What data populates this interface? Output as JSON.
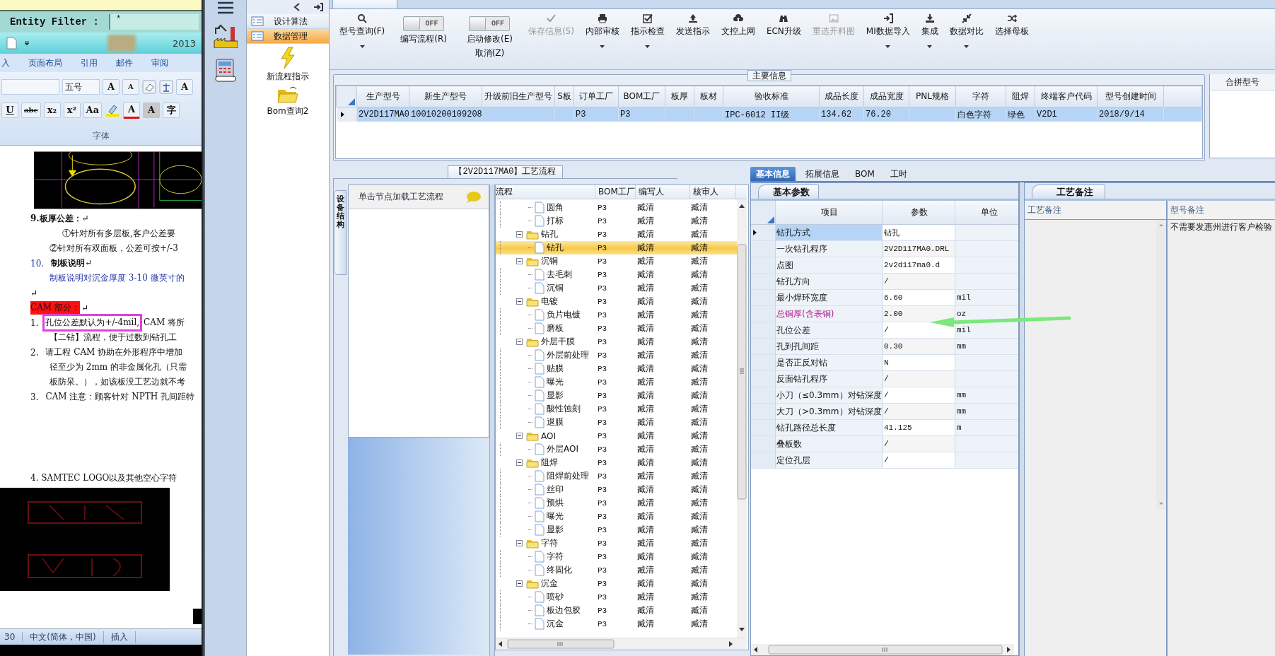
{
  "entity_filter": {
    "label": "Entity Filter :",
    "value": "*"
  },
  "word_window": {
    "title_fragment": "2013",
    "ribbon_tabs": [
      "入",
      "页面布局",
      "引用",
      "邮件",
      "审阅"
    ],
    "font_size": "五号",
    "row1_buttons": [
      "A",
      "A",
      "A"
    ],
    "row2_buttons": [
      "U",
      "abc",
      "x₂",
      "x²",
      "Aa",
      "A",
      "A",
      "字"
    ],
    "group_label": "字体",
    "document": [
      {
        "kind": "picture"
      },
      {
        "kind": "para",
        "text": "**9.板厚公差：**↵"
      },
      {
        "kind": "deep",
        "text": "①针对所有多层板,客户公差要"
      },
      {
        "kind": "sub",
        "text": "②针对所有双面板，公差可按+/-3"
      },
      {
        "kind": "numbered_heading",
        "number": "10.",
        "text": "**制板说明**↵"
      },
      {
        "kind": "note",
        "text": "制板说明对沉金厚度 3-10 微英寸的"
      },
      {
        "kind": "para",
        "text": "↵"
      },
      {
        "kind": "alert",
        "text": "CAM 部分：",
        "mark": "↵"
      },
      {
        "kind": "numbered",
        "number": "1.",
        "boxed": "孔位公差默认为+/-4mil,",
        "text": "CAM 将所"
      },
      {
        "kind": "sub",
        "text": "【二钻】流程，便于过数到钻孔工"
      },
      {
        "kind": "numbered",
        "number": "2.",
        "text": "请工程 CAM 协助在外形程序中增加"
      },
      {
        "kind": "sub",
        "text": "径至少为 2mm 的非金属化孔（只需"
      },
      {
        "kind": "sub",
        "text": "板防呆。），如该板没工艺边就不考"
      },
      {
        "kind": "numbered",
        "number": "3.",
        "text": "CAM 注意：顾客针对 NPTH 孔间距特"
      },
      {
        "kind": "spaced",
        "text": "4. SAMTEC LOGO以及其他空心字符"
      },
      {
        "kind": "picture"
      }
    ],
    "status_bar": [
      "30",
      "中文(简体，中国)",
      "插入"
    ]
  },
  "component_panel": {
    "nav": [
      {
        "label": "设计算法",
        "selected": false
      },
      {
        "label": "数据管理",
        "selected": true
      }
    ],
    "tools": [
      "新流程指示",
      "Bom查询2"
    ]
  },
  "toolbar": [
    {
      "kind": "button",
      "label": "型号查询(F)",
      "disabled": false,
      "dropdown": true
    },
    {
      "kind": "toggle",
      "label": "编写流程(R)",
      "state_text": "OFF",
      "on": false
    },
    {
      "kind": "toggle",
      "label": "启动修改(E)",
      "sublabel": "取消(Z)",
      "state_text": "OFF",
      "on": false
    },
    {
      "kind": "button",
      "label": "保存信息(S)",
      "disabled": true,
      "dropdown": false
    },
    {
      "kind": "button",
      "label": "内部审核",
      "disabled": false,
      "dropdown": true
    },
    {
      "kind": "button",
      "label": "指示检查",
      "disabled": false,
      "dropdown": true
    },
    {
      "kind": "button",
      "label": "发送指示",
      "disabled": false,
      "dropdown": false
    },
    {
      "kind": "button",
      "label": "文控上网",
      "disabled": false,
      "dropdown": false
    },
    {
      "kind": "button",
      "label": "ECN升级",
      "disabled": false,
      "dropdown": false
    },
    {
      "kind": "button",
      "label": "重选开料图",
      "disabled": true,
      "dropdown": false
    },
    {
      "kind": "button",
      "label": "MI数据导入",
      "disabled": false,
      "dropdown": true
    },
    {
      "kind": "button",
      "label": "集成",
      "disabled": false,
      "dropdown": true
    },
    {
      "kind": "button",
      "label": "数据对比",
      "disabled": false,
      "dropdown": true
    },
    {
      "kind": "button",
      "label": "选择母板",
      "disabled": false,
      "dropdown": false
    }
  ],
  "main_info": {
    "title": "主要信息",
    "columns": [
      "生产型号",
      "新生产型号",
      "升级前旧生产型号",
      "S板",
      "订单工厂",
      "BOM工厂",
      "板厚",
      "板材",
      "验收标准",
      "成品长度",
      "成品宽度",
      "PNL规格",
      "字符",
      "阻焊",
      "终端客户代码",
      "型号创建时间"
    ],
    "rows": [
      {
        "selected": true,
        "cells": [
          "2V2D117MA0",
          "10010200109208",
          "",
          "",
          "P3",
          "P3",
          "",
          "",
          "IPC-6012 II级",
          "134.62",
          "76.20",
          "",
          "白色字符",
          "绿色",
          "V2D1",
          "2018/9/14"
        ]
      }
    ],
    "side_panel_title": "合拼型号"
  },
  "process": {
    "title": "【2V2D117MA0】工艺流程",
    "side_tab": "设备结构",
    "hint": "单击节点加载工艺流程",
    "columns": [
      "流程",
      "BOM工厂",
      "编写人",
      "核审人"
    ],
    "nodes": [
      {
        "children": [
          {
            "label": "圆角",
            "bom": "P3",
            "writer": "臧清",
            "reviewer": "臧清",
            "selected": false
          },
          {
            "label": "打标",
            "bom": "P3",
            "writer": "臧清",
            "reviewer": "臧清",
            "selected": false
          }
        ]
      },
      {
        "label": "钻孔",
        "bom": "P3",
        "writer": "臧清",
        "reviewer": "臧清",
        "expanded": true,
        "selected": false,
        "children": [
          {
            "label": "钻孔",
            "bom": "P3",
            "writer": "臧清",
            "reviewer": "臧清",
            "selected": true
          }
        ]
      },
      {
        "label": "沉铜",
        "bom": "P3",
        "writer": "臧清",
        "reviewer": "臧清",
        "expanded": true,
        "selected": false,
        "children": [
          {
            "label": "去毛刺",
            "bom": "P3",
            "writer": "臧清",
            "reviewer": "臧清",
            "selected": false
          },
          {
            "label": "沉铜",
            "bom": "P3",
            "writer": "臧清",
            "reviewer": "臧清",
            "selected": false
          }
        ]
      },
      {
        "label": "电镀",
        "bom": "P3",
        "writer": "臧清",
        "reviewer": "臧清",
        "expanded": true,
        "selected": false,
        "children": [
          {
            "label": "负片电镀",
            "bom": "P3",
            "writer": "臧清",
            "reviewer": "臧清",
            "selected": false
          },
          {
            "label": "磨板",
            "bom": "P3",
            "writer": "臧清",
            "reviewer": "臧清",
            "selected": false
          }
        ]
      },
      {
        "label": "外层干膜",
        "bom": "P3",
        "writer": "臧清",
        "reviewer": "臧清",
        "expanded": true,
        "selected": false,
        "children": [
          {
            "label": "外层前处理",
            "bom": "P3",
            "writer": "臧清",
            "reviewer": "臧清",
            "selected": false
          },
          {
            "label": "贴膜",
            "bom": "P3",
            "writer": "臧清",
            "reviewer": "臧清",
            "selected": false
          },
          {
            "label": "曝光",
            "bom": "P3",
            "writer": "臧清",
            "reviewer": "臧清",
            "selected": false
          },
          {
            "label": "显影",
            "bom": "P3",
            "writer": "臧清",
            "reviewer": "臧清",
            "selected": false
          },
          {
            "label": "酸性蚀刻",
            "bom": "P3",
            "writer": "臧清",
            "reviewer": "臧清",
            "selected": false
          },
          {
            "label": "退膜",
            "bom": "P3",
            "writer": "臧清",
            "reviewer": "臧清",
            "selected": false
          }
        ]
      },
      {
        "label": "AOI",
        "bom": "P3",
        "writer": "臧清",
        "reviewer": "臧清",
        "expanded": true,
        "selected": false,
        "children": [
          {
            "label": "外层AOI",
            "bom": "P3",
            "writer": "臧清",
            "reviewer": "臧清",
            "selected": false
          }
        ]
      },
      {
        "label": "阻焊",
        "bom": "P3",
        "writer": "臧清",
        "reviewer": "臧清",
        "expanded": true,
        "selected": false,
        "children": [
          {
            "label": "阻焊前处理",
            "bom": "P3",
            "writer": "臧清",
            "reviewer": "臧清",
            "selected": false
          },
          {
            "label": "丝印",
            "bom": "P3",
            "writer": "臧清",
            "reviewer": "臧清",
            "selected": false
          },
          {
            "label": "预烘",
            "bom": "P3",
            "writer": "臧清",
            "reviewer": "臧清",
            "selected": false
          },
          {
            "label": "曝光",
            "bom": "P3",
            "writer": "臧清",
            "reviewer": "臧清",
            "selected": false
          },
          {
            "label": "显影",
            "bom": "P3",
            "writer": "臧清",
            "reviewer": "臧清",
            "selected": false
          }
        ]
      },
      {
        "label": "字符",
        "bom": "P3",
        "writer": "臧清",
        "reviewer": "臧清",
        "expanded": true,
        "selected": false,
        "children": [
          {
            "label": "字符",
            "bom": "P3",
            "writer": "臧清",
            "reviewer": "臧清",
            "selected": false
          },
          {
            "label": "终固化",
            "bom": "P3",
            "writer": "臧清",
            "reviewer": "臧清",
            "selected": false
          }
        ]
      },
      {
        "label": "沉金",
        "bom": "P3",
        "writer": "臧清",
        "reviewer": "臧清",
        "expanded": true,
        "selected": false,
        "children": [
          {
            "label": "喷砂",
            "bom": "P3",
            "writer": "臧清",
            "reviewer": "臧清",
            "selected": false
          },
          {
            "label": "板边包胶",
            "bom": "P3",
            "writer": "臧清",
            "reviewer": "臧清",
            "selected": false
          },
          {
            "label": "沉金",
            "bom": "P3",
            "writer": "臧清",
            "reviewer": "臧清",
            "selected": false
          }
        ]
      }
    ]
  },
  "detail_tabs": [
    {
      "label": "基本信息",
      "selected": true
    },
    {
      "label": "拓展信息",
      "selected": false
    },
    {
      "label": "BOM",
      "selected": false
    },
    {
      "label": "工时",
      "selected": false
    }
  ],
  "params": {
    "tab": "基本参数",
    "columns": [
      "项目",
      "参数",
      "单位"
    ],
    "rows": [
      {
        "item": "钻孔方式",
        "value": "钻孔",
        "selected": true,
        "emphasis": false
      },
      {
        "item": "一次钻孔程序",
        "value": "2V2D117MA0.DRL",
        "selected": false,
        "emphasis": false
      },
      {
        "item": "点图",
        "value": "2v2d117ma0.d",
        "selected": false,
        "emphasis": false
      },
      {
        "item": "钻孔方向",
        "value": "/",
        "selected": false,
        "emphasis": false
      },
      {
        "item": "最小焊环宽度",
        "value": "6.60",
        "unit": "mil",
        "selected": false,
        "emphasis": false
      },
      {
        "item": "总铜厚(含表铜)",
        "value": "2.00",
        "unit": "oz",
        "selected": false,
        "emphasis": true
      },
      {
        "item": "孔位公差",
        "value": "/",
        "unit": "mil",
        "selected": false,
        "emphasis": false
      },
      {
        "item": "孔到孔间距",
        "value": "0.30",
        "unit": "mm",
        "selected": false,
        "emphasis": false
      },
      {
        "item": "是否正反对钻",
        "value": "N",
        "selected": false,
        "emphasis": false
      },
      {
        "item": "反面钻孔程序",
        "value": "/",
        "selected": false,
        "emphasis": false
      },
      {
        "item": "小刀（≤0.3mm）对钻深度",
        "value": "/",
        "unit": "mm",
        "selected": false,
        "emphasis": false
      },
      {
        "item": "大刀（>0.3mm）对钻深度",
        "value": "/",
        "unit": "mm",
        "selected": false,
        "emphasis": false
      },
      {
        "item": "钻孔路径总长度",
        "value": "41.125",
        "unit": "m",
        "selected": false,
        "emphasis": false
      },
      {
        "item": "叠板数",
        "value": "/",
        "selected": false,
        "emphasis": false
      },
      {
        "item": "定位孔层",
        "value": "/",
        "selected": false,
        "emphasis": false
      }
    ]
  },
  "remarks": {
    "tab": "工艺备注",
    "columns": [
      "工艺备注",
      "型号备注"
    ],
    "model_note": "不需要发惠州进行客户检验"
  }
}
